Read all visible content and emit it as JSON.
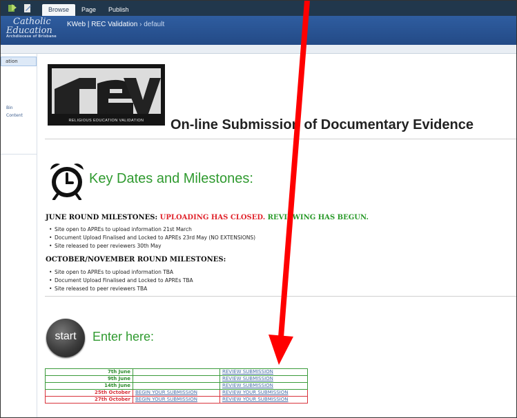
{
  "ribbon": {
    "tabs": [
      "Browse",
      "Page",
      "Publish"
    ],
    "active_tab": "Browse"
  },
  "brand": {
    "line1": "Catholic",
    "line2": "Education",
    "line3": "Archdiocese of Brisbane"
  },
  "breadcrumb": {
    "site": "KWeb",
    "page": "REC Validation",
    "separator": "›",
    "current": "default"
  },
  "left_nav": {
    "selected": "ation",
    "links": [
      "Bin",
      "Content"
    ]
  },
  "logo": {
    "letters": "rev",
    "caption": "RELIGIOUS EDUCATION VALIDATION"
  },
  "page_title": "On-line Submission of Documentary Evidence",
  "key_dates_title": "Key Dates and Milestones:",
  "june": {
    "heading": "JUNE ROUND MILESTONES: ",
    "status_closed": "UPLOADING HAS CLOSED.",
    "status_begun": "REVIEWING HAS BEGUN.",
    "items": [
      "Site open to APREs to upload information 21st March",
      "Document Upload Finalised and Locked to APREs 23rd May (NO EXTENSIONS)",
      "Site released to peer reviewers 30th May"
    ]
  },
  "october": {
    "heading": "OCTOBER/NOVEMBER ROUND MILESTONES:",
    "items": [
      "Site open to APREs to upload information TBA",
      "Document Upload Finalised and Locked to APREs TBA",
      "Site released to peer reviewers TBA"
    ]
  },
  "start_label": "start",
  "enter_title": "Enter here:",
  "submissions": [
    {
      "date": "7th June",
      "begin": "",
      "review": "REVIEW SUBMISSION",
      "color": "green"
    },
    {
      "date": "9th June",
      "begin": "",
      "review": "REVIEW SUBMISSION",
      "color": "green"
    },
    {
      "date": "14th June",
      "begin": "",
      "review": "REVIEW SUBMISSION",
      "color": "green"
    },
    {
      "date": "25th October",
      "begin": "BEGIN YOUR SUBMISSION",
      "review": "REVIEW YOUR SUBMISSION",
      "color": "red"
    },
    {
      "date": "27th October",
      "begin": "BEGIN YOUR SUBMISSION",
      "review": "REVIEW YOUR SUBMISSION",
      "color": "red"
    }
  ],
  "colors": {
    "green": "#2f9a2f",
    "red": "#e0242c",
    "banner": "#2f5da0",
    "annotation_arrow": "#ff0000"
  }
}
